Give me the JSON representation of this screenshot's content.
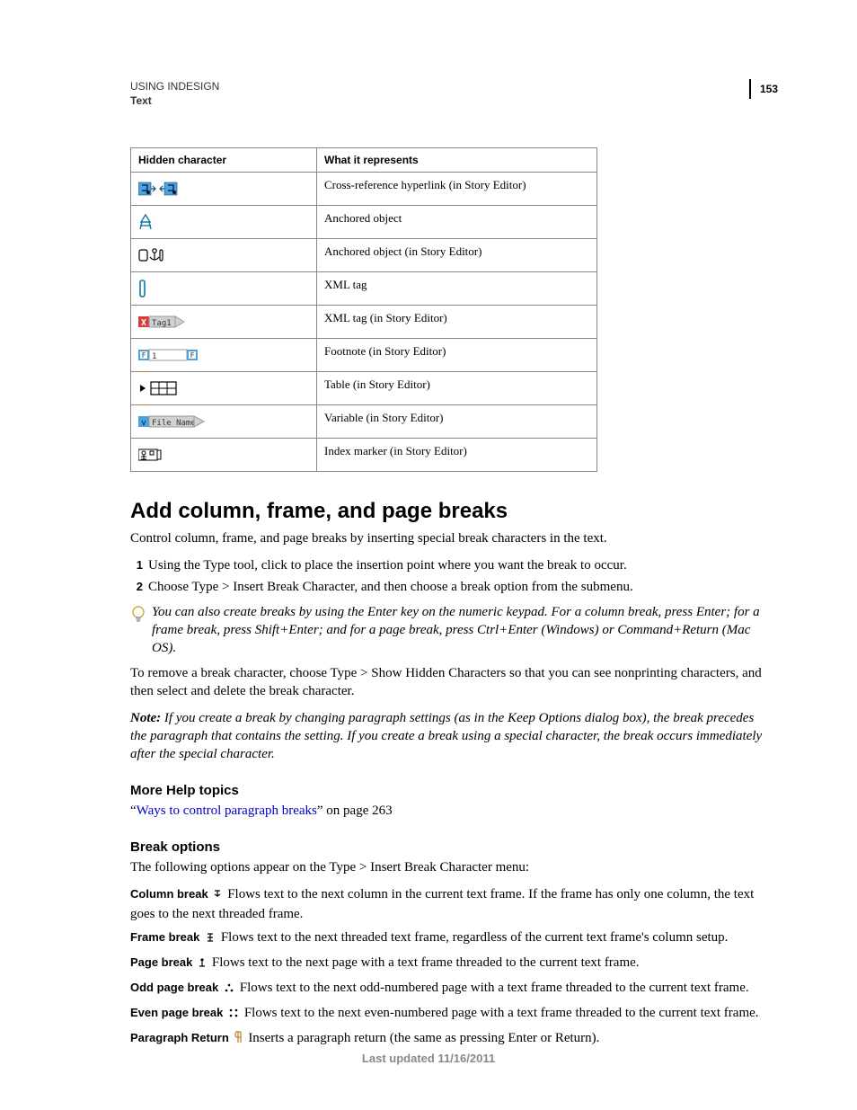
{
  "page_number": "153",
  "doc_header": {
    "line1": "USING INDESIGN",
    "line2": "Text"
  },
  "table": {
    "headers": [
      "Hidden character",
      "What it represents"
    ],
    "rows": [
      {
        "icon_key": "xref_hyperlink",
        "desc": "Cross-reference hyperlink (in Story Editor)"
      },
      {
        "icon_key": "anchored_obj",
        "desc": "Anchored object"
      },
      {
        "icon_key": "anchored_obj_se",
        "desc": "Anchored object (in Story Editor)"
      },
      {
        "icon_key": "xml_tag",
        "desc": "XML tag"
      },
      {
        "icon_key": "xml_tag_se",
        "desc": "XML tag (in Story Editor)"
      },
      {
        "icon_key": "footnote_se",
        "desc": "Footnote (in Story Editor)"
      },
      {
        "icon_key": "table_se",
        "desc": "Table (in Story Editor)"
      },
      {
        "icon_key": "variable_se",
        "desc": "Variable (in Story Editor)"
      },
      {
        "icon_key": "index_se",
        "desc": "Index marker (in Story Editor)"
      }
    ]
  },
  "section": {
    "heading": "Add column, frame, and page breaks",
    "intro": "Control column, frame, and page breaks by inserting special break characters in the text.",
    "steps": [
      "Using the Type tool, click to place the insertion point where you want the break to occur.",
      "Choose Type > Insert Break Character, and then choose a break option from the submenu."
    ],
    "tip": "You can also create breaks by using the Enter key on the numeric keypad. For a column break, press Enter; for a frame break, press Shift+Enter; and for a page break, press Ctrl+Enter (Windows) or Command+Return (Mac OS).",
    "para_remove": "To remove a break character, choose Type > Show Hidden Characters so that you can see nonprinting characters, and then select and delete the break character.",
    "note_label": "Note:",
    "note": "If you create a break by changing paragraph settings (as in the Keep Options dialog box), the break precedes the paragraph that contains the setting. If you create a break using a special character, the break occurs immediately after the special character."
  },
  "more_help": {
    "heading": "More Help topics",
    "link_text": "Ways to control paragraph breaks",
    "suffix_before": "“",
    "suffix_after": "” on page 263"
  },
  "break_options": {
    "heading": "Break options",
    "intro": "The following options appear on the Type > Insert Break Character menu:",
    "items": [
      {
        "term": "Column break",
        "icon": "col",
        "desc": "Flows text to the next column in the current text frame. If the frame has only one column, the text goes to the next threaded frame."
      },
      {
        "term": "Frame break",
        "icon": "frame",
        "desc": "Flows text to the next threaded text frame, regardless of the current text frame's column setup."
      },
      {
        "term": "Page break",
        "icon": "page",
        "desc": "Flows text to the next page with a text frame threaded to the current text frame."
      },
      {
        "term": "Odd page break",
        "icon": "odd",
        "desc": "Flows text to the next odd-numbered page with a text frame threaded to the current text frame."
      },
      {
        "term": "Even page break",
        "icon": "even",
        "desc": "Flows text to the next even-numbered page with a text frame threaded to the current text frame."
      },
      {
        "term": "Paragraph Return",
        "icon": "para",
        "desc": "Inserts a paragraph return (the same as pressing Enter or Return)."
      }
    ]
  },
  "footer": "Last updated 11/16/2011",
  "icon_name_map": {
    "xref_hyperlink": "crossref-hyperlink-icon",
    "anchored_obj": "anchored-object-icon",
    "anchored_obj_se": "anchored-object-storyeditor-icon",
    "xml_tag": "xml-tag-icon",
    "xml_tag_se": "xml-tag-storyeditor-icon",
    "footnote_se": "footnote-storyeditor-icon",
    "table_se": "table-storyeditor-icon",
    "variable_se": "variable-storyeditor-icon",
    "index_se": "index-marker-storyeditor-icon"
  },
  "icon_label_map": {
    "xml_tag_se": "Tag1",
    "variable_se": "File Name"
  },
  "mini_icon_name_map": {
    "col": "column-break-icon",
    "frame": "frame-break-icon",
    "page": "page-break-icon",
    "odd": "odd-page-break-icon",
    "even": "even-page-break-icon",
    "para": "paragraph-return-icon"
  }
}
